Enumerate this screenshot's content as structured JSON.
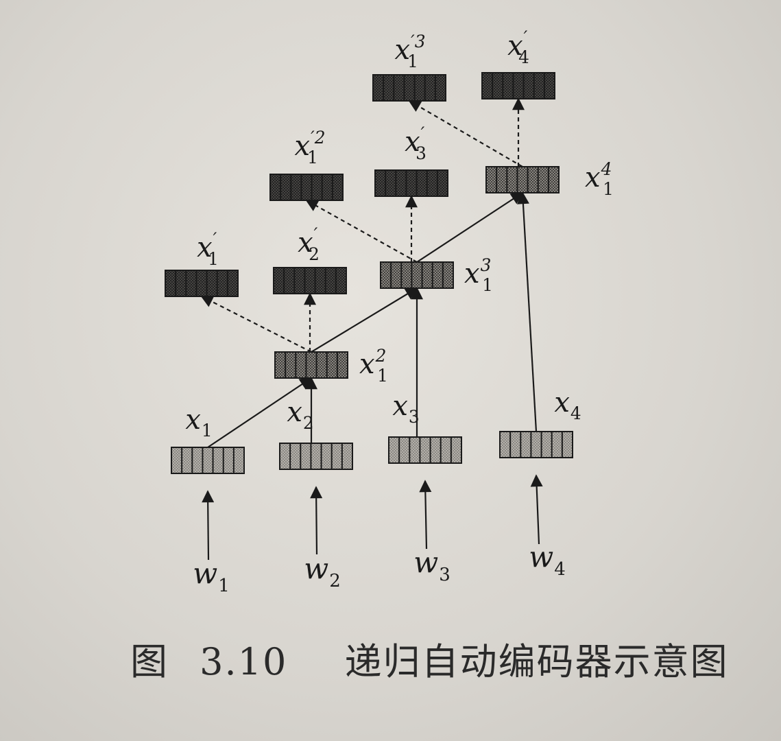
{
  "caption": {
    "figure_word": "图",
    "figure_number": "3.10",
    "title": "递归自动编码器示意图"
  },
  "nodes": [
    {
      "id": "x1",
      "label": "x1",
      "base": "x",
      "sub": "1",
      "sup": "",
      "style": "light"
    },
    {
      "id": "x2",
      "label": "x2",
      "base": "x",
      "sub": "2",
      "sup": "",
      "style": "light"
    },
    {
      "id": "x3",
      "label": "x3",
      "base": "x",
      "sub": "3",
      "sup": "",
      "style": "light"
    },
    {
      "id": "x4",
      "label": "x4",
      "base": "x",
      "sub": "4",
      "sup": "",
      "style": "light"
    },
    {
      "id": "x1_2",
      "label": "x1^2",
      "base": "x",
      "sub": "1",
      "sup": "2",
      "style": "medium"
    },
    {
      "id": "x1_3",
      "label": "x1^3",
      "base": "x",
      "sub": "1",
      "sup": "3",
      "style": "medium"
    },
    {
      "id": "x1_4",
      "label": "x1^4",
      "base": "x",
      "sub": "1",
      "sup": "4",
      "style": "medium"
    },
    {
      "id": "x1p",
      "label": "x1'",
      "base": "x",
      "sub": "1",
      "sup": "′",
      "style": "dark"
    },
    {
      "id": "x2p",
      "label": "x2'",
      "base": "x",
      "sub": "2",
      "sup": "′",
      "style": "dark"
    },
    {
      "id": "x1p2",
      "label": "x1'2",
      "base": "x",
      "sub": "1",
      "sup": "′2",
      "style": "dark"
    },
    {
      "id": "x3p",
      "label": "x3'",
      "base": "x",
      "sub": "3",
      "sup": "′",
      "style": "dark"
    },
    {
      "id": "x1p3",
      "label": "x1'3",
      "base": "x",
      "sub": "1",
      "sup": "′3",
      "style": "dark"
    },
    {
      "id": "x4p",
      "label": "x4'",
      "base": "x",
      "sub": "4",
      "sup": "′",
      "style": "dark"
    }
  ],
  "inputs": [
    {
      "id": "w1",
      "base": "w",
      "sub": "1"
    },
    {
      "id": "w2",
      "base": "w",
      "sub": "2"
    },
    {
      "id": "w3",
      "base": "w",
      "sub": "3"
    },
    {
      "id": "w4",
      "base": "w",
      "sub": "4"
    }
  ],
  "edges": [
    {
      "from": "w1",
      "to": "x1",
      "style": "solid"
    },
    {
      "from": "w2",
      "to": "x2",
      "style": "solid"
    },
    {
      "from": "w3",
      "to": "x3",
      "style": "solid"
    },
    {
      "from": "w4",
      "to": "x4",
      "style": "solid"
    },
    {
      "from": "x1",
      "to": "x1_2",
      "style": "solid"
    },
    {
      "from": "x2",
      "to": "x1_2",
      "style": "solid"
    },
    {
      "from": "x1_2",
      "to": "x1p",
      "style": "dashed"
    },
    {
      "from": "x1_2",
      "to": "x2p",
      "style": "dashed"
    },
    {
      "from": "x1_2",
      "to": "x1_3",
      "style": "solid"
    },
    {
      "from": "x3",
      "to": "x1_3",
      "style": "solid"
    },
    {
      "from": "x1_3",
      "to": "x1p2",
      "style": "dashed"
    },
    {
      "from": "x1_3",
      "to": "x3p",
      "style": "dashed"
    },
    {
      "from": "x1_3",
      "to": "x1_4",
      "style": "solid"
    },
    {
      "from": "x4",
      "to": "x1_4",
      "style": "solid"
    },
    {
      "from": "x1_4",
      "to": "x1p3",
      "style": "dashed"
    },
    {
      "from": "x1_4",
      "to": "x4p",
      "style": "dashed"
    }
  ],
  "colors": {
    "ink": "#1a1a1a",
    "light_fill": "#a9a6a0",
    "medium_fill": "#6f6c67",
    "dark_fill": "#3a3835"
  }
}
